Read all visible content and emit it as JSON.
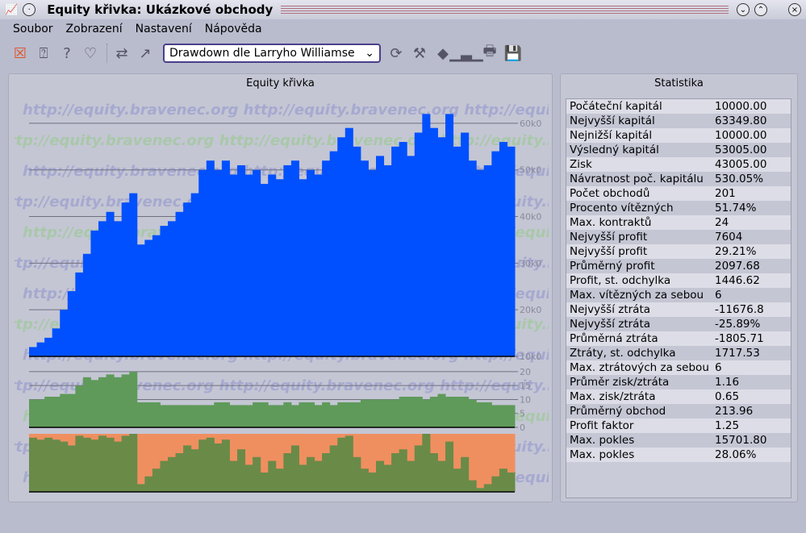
{
  "window": {
    "title": "Equity křivka: Ukázkové obchody"
  },
  "menu": [
    "Soubor",
    "Zobrazení",
    "Nastavení",
    "Nápověda"
  ],
  "toolbar": {
    "combo_value": "Drawdown dle Larryho Williamse"
  },
  "chart_panel": {
    "title": "Equity křivka",
    "watermark": "http://equity.bravenec.org"
  },
  "stats_panel": {
    "title": "Statistika"
  },
  "stats": [
    [
      "Počáteční kapitál",
      "10000.00"
    ],
    [
      "Nejvyšší kapitál",
      "63349.80"
    ],
    [
      "Nejnižší kapitál",
      "10000.00"
    ],
    [
      "Výsledný kapitál",
      "53005.00"
    ],
    [
      "Zisk",
      "43005.00"
    ],
    [
      "Návratnost poč. kapitálu",
      "530.05%"
    ],
    [
      "Počet obchodů",
      "201"
    ],
    [
      "Procento vítězných",
      "51.74%"
    ],
    [
      "Max. kontraktů",
      "24"
    ],
    [
      "Nejvyšší profit",
      "7604"
    ],
    [
      "Nejvyšší profit",
      "29.21%"
    ],
    [
      "Průměrný profit",
      "2097.68"
    ],
    [
      "Profit, st. odchylka",
      "1446.62"
    ],
    [
      "Max. vítězných za sebou",
      "6"
    ],
    [
      "Nejvyšší ztráta",
      "-11676.8"
    ],
    [
      "Nejvyšší ztráta",
      "-25.89%"
    ],
    [
      "Průměrná ztráta",
      "-1805.71"
    ],
    [
      "Ztráty, st. odchylka",
      "1717.53"
    ],
    [
      "Max. ztrátových za sebou",
      "6"
    ],
    [
      "Průměr zisk/ztráta",
      "1.16"
    ],
    [
      "Max. zisk/ztráta",
      "0.65"
    ],
    [
      "Průměrný obchod",
      "213.96"
    ],
    [
      "Profit faktor",
      "1.25"
    ],
    [
      "Max. pokles",
      "15701.80"
    ],
    [
      "Max. pokles",
      "28.06%"
    ]
  ],
  "chart_data": [
    {
      "type": "bar",
      "title": "Equity",
      "ylim": [
        10000,
        65000
      ],
      "ticks": [
        "10k0",
        "20k0",
        "30k0",
        "40k0",
        "50k0",
        "60k0"
      ],
      "tick_values": [
        10000,
        20000,
        30000,
        40000,
        50000,
        60000
      ],
      "color": "#0050ff",
      "values": [
        12000,
        13000,
        14000,
        16000,
        20000,
        24000,
        28000,
        32000,
        37000,
        39000,
        41000,
        39000,
        43000,
        45000,
        34000,
        35000,
        36000,
        38000,
        39000,
        41000,
        43000,
        45000,
        50000,
        52000,
        50000,
        52000,
        49000,
        51000,
        49000,
        50000,
        47000,
        49000,
        48000,
        51000,
        52000,
        48000,
        50000,
        49000,
        52000,
        54000,
        57000,
        59000,
        55000,
        52000,
        50000,
        53000,
        51000,
        55000,
        56000,
        53000,
        58000,
        62000,
        59000,
        57000,
        62000,
        55000,
        58000,
        52000,
        50000,
        51000,
        54000,
        56000,
        55000
      ]
    },
    {
      "type": "bar",
      "title": "Contracts",
      "ylim": [
        0,
        22
      ],
      "ticks": [
        "0",
        "5",
        "10",
        "15",
        "20"
      ],
      "tick_values": [
        0,
        5,
        10,
        15,
        20
      ],
      "color": "#5f9a5a",
      "values": [
        10,
        10,
        11,
        11,
        12,
        12,
        15,
        18,
        17,
        18,
        19,
        18,
        19,
        20,
        9,
        9,
        9,
        8,
        8,
        8,
        8,
        8,
        8,
        8,
        9,
        9,
        8,
        8,
        8,
        9,
        9,
        8,
        8,
        9,
        8,
        9,
        9,
        8,
        9,
        8,
        9,
        9,
        9,
        10,
        10,
        10,
        10,
        10,
        11,
        11,
        11,
        10,
        11,
        12,
        11,
        11,
        11,
        10,
        9,
        9,
        8,
        8,
        8
      ]
    },
    {
      "type": "area",
      "title": "Drawdown",
      "ylim": [
        0,
        30
      ],
      "color_max": "#ef8f60",
      "color_cur": "#6a8a48",
      "max": [
        3,
        3,
        3,
        3,
        4,
        6,
        8,
        8,
        8,
        8,
        8,
        8,
        8,
        8,
        26,
        26,
        26,
        26,
        26,
        26,
        26,
        26,
        26,
        26,
        26,
        26,
        26,
        26,
        26,
        26,
        26,
        26,
        26,
        26,
        26,
        26,
        26,
        26,
        26,
        26,
        26,
        26,
        26,
        26,
        26,
        26,
        26,
        26,
        26,
        26,
        26,
        26,
        26,
        26,
        26,
        26,
        26,
        26,
        28,
        28,
        28,
        28,
        28
      ],
      "cur": [
        2,
        3,
        2,
        3,
        4,
        6,
        1,
        2,
        3,
        1,
        2,
        4,
        1,
        0,
        26,
        22,
        18,
        14,
        12,
        10,
        6,
        8,
        3,
        2,
        5,
        3,
        14,
        8,
        16,
        12,
        20,
        14,
        18,
        10,
        6,
        16,
        12,
        14,
        10,
        6,
        2,
        1,
        12,
        18,
        20,
        14,
        16,
        10,
        8,
        14,
        6,
        0,
        10,
        14,
        4,
        18,
        12,
        24,
        28,
        26,
        22,
        18,
        20
      ]
    }
  ]
}
